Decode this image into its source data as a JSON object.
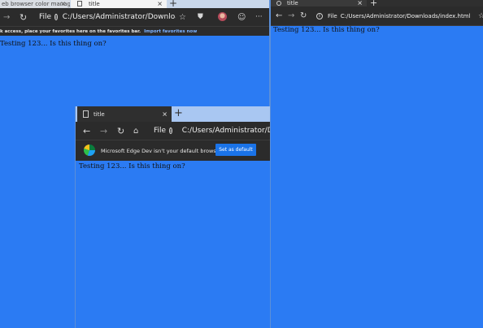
{
  "colors": {
    "page_bg": "#2b7bf3",
    "chrome_dark": "#2b2b2b",
    "tab_bg": "#3a3a3a",
    "accent_button": "#1a73e8"
  },
  "window_left": {
    "tabs": [
      {
        "label": "eb browser color management"
      },
      {
        "label": "title"
      }
    ],
    "address": {
      "scheme_label": "File",
      "url": "C:/Users/Administrator/Downloads/i..."
    },
    "favorites_bar": {
      "text": "k access, place your favorites here on the favorites bar.",
      "link": "Import favorites now"
    },
    "content_text": "Testing 123... Is this thing on?"
  },
  "window_right": {
    "tabs": [
      {
        "label": "title"
      }
    ],
    "address": {
      "scheme_label": "File",
      "url": "C:/Users/Administrator/Downloads/index.html"
    },
    "content_text": "Testing 123... Is this thing on?"
  },
  "window_middle": {
    "tabs": [
      {
        "label": "title"
      }
    ],
    "address": {
      "scheme_label": "File",
      "url": "C:/Users/Administrator/Downloa"
    },
    "notification": {
      "message": "Microsoft Edge Dev isn't your default browser",
      "button_label": "Set as default"
    },
    "content_text": "Testing 123... Is this thing on?"
  }
}
